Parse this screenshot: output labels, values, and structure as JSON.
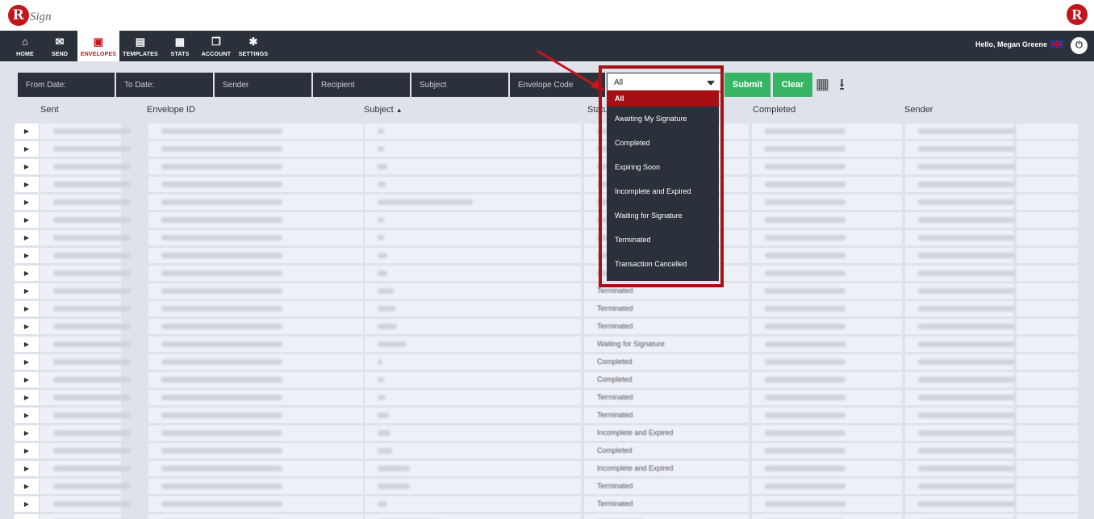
{
  "header": {
    "logo_text": "Sign",
    "logo_letter": "R",
    "greeting": "Hello, Megan Greene"
  },
  "nav": {
    "items": [
      {
        "label": "HOME",
        "icon": "home-icon",
        "glyph": "⌂"
      },
      {
        "label": "SEND",
        "icon": "envelope-icon",
        "glyph": "✉"
      },
      {
        "label": "ENVELOPES",
        "icon": "inbox-icon",
        "glyph": "▣",
        "active": true
      },
      {
        "label": "TEMPLATES",
        "icon": "document-icon",
        "glyph": "▤"
      },
      {
        "label": "STATS",
        "icon": "briefcase-icon",
        "glyph": "▦"
      },
      {
        "label": "ACCOUNT",
        "icon": "copy-icon",
        "glyph": "❐"
      },
      {
        "label": "SETTINGS",
        "icon": "gear-icon",
        "glyph": "✱"
      }
    ]
  },
  "filters": {
    "from_date": "From Date:",
    "to_date": "To Date:",
    "sender": "Sender",
    "recipient": "Recipient",
    "subject": "Subject",
    "envelope_code": "Envelope Code",
    "status_selected": "All",
    "submit_label": "Submit",
    "clear_label": "Clear"
  },
  "table": {
    "columns": [
      "Sent",
      "Envelope ID",
      "Subject",
      "Status",
      "Completed",
      "Sender"
    ],
    "visible_status_values": [
      "Terminated",
      "Terminated",
      "Terminated",
      "Waiting for Signature",
      "Completed",
      "Completed",
      "Terminated",
      "Terminated",
      "Incomplete and Expired",
      "Completed",
      "Incomplete and Expired",
      "Terminated",
      "Terminated"
    ]
  },
  "status_dropdown": {
    "options": [
      "All",
      "Awaiting My Signature",
      "Completed",
      "Expiring Soon",
      "Incomplete and Expired",
      "Waiting for Signature",
      "Terminated",
      "Transaction Cancelled"
    ]
  },
  "colors": {
    "nav_bg": "#2b313b",
    "brand_red": "#c3161c",
    "highlight_red": "#a91014",
    "green_button": "#37b564",
    "page_bg": "#dfe2ea"
  }
}
